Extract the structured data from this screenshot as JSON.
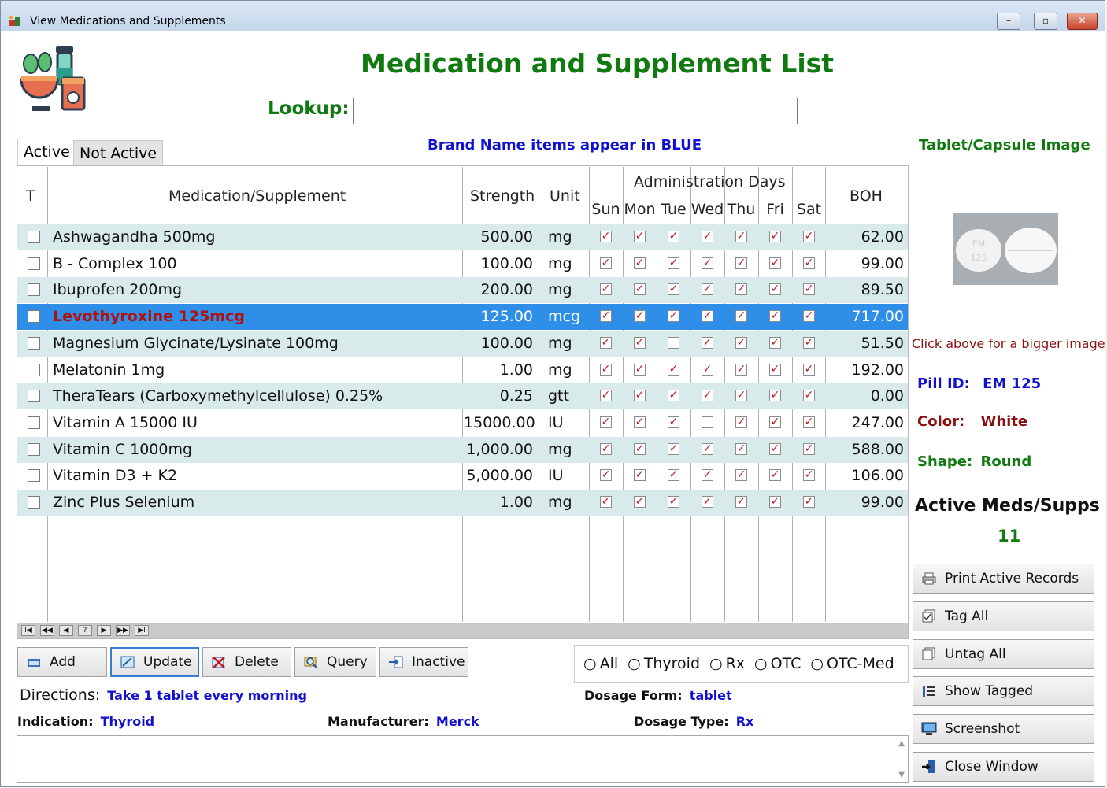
{
  "window": {
    "title": "View Medications and Supplements",
    "minimize": "–",
    "maximize": "▫",
    "close": "✕"
  },
  "heading": "Medication and Supplement List",
  "lookup": {
    "label": "Lookup:",
    "value": ""
  },
  "tabs": [
    {
      "label": "Active"
    },
    {
      "label": "Not Active"
    }
  ],
  "brand_note": "Brand Name items appear in BLUE",
  "table": {
    "headers": {
      "tag": "T",
      "name": "Medication/Supplement",
      "strength": "Strength",
      "unit": "Unit",
      "admin": "Administration Days",
      "boh": "BOH"
    },
    "days": [
      "Sun",
      "Mon",
      "Tue",
      "Wed",
      "Thu",
      "Fri",
      "Sat"
    ],
    "rows": [
      {
        "name": "Ashwagandha 500mg",
        "strength": "500.00",
        "unit": "mg",
        "days": [
          true,
          true,
          true,
          true,
          true,
          true,
          true
        ],
        "boh": "62.00",
        "selected": false
      },
      {
        "name": "B - Complex 100",
        "strength": "100.00",
        "unit": "mg",
        "days": [
          true,
          true,
          true,
          true,
          true,
          true,
          true
        ],
        "boh": "99.00",
        "selected": false
      },
      {
        "name": "Ibuprofen 200mg",
        "strength": "200.00",
        "unit": "mg",
        "days": [
          true,
          true,
          true,
          true,
          true,
          true,
          true
        ],
        "boh": "89.50",
        "selected": false
      },
      {
        "name": "Levothyroxine 125mcg",
        "strength": "125.00",
        "unit": "mcg",
        "days": [
          true,
          true,
          true,
          true,
          true,
          true,
          true
        ],
        "boh": "717.00",
        "selected": true
      },
      {
        "name": "Magnesium Glycinate/Lysinate 100mg",
        "strength": "100.00",
        "unit": "mg",
        "days": [
          true,
          true,
          false,
          true,
          true,
          true,
          true
        ],
        "boh": "51.50",
        "selected": false
      },
      {
        "name": "Melatonin 1mg",
        "strength": "1.00",
        "unit": "mg",
        "days": [
          true,
          true,
          true,
          true,
          true,
          true,
          true
        ],
        "boh": "192.00",
        "selected": false
      },
      {
        "name": "TheraTears (Carboxymethylcellulose) 0.25%",
        "strength": "0.25",
        "unit": "gtt",
        "days": [
          true,
          true,
          true,
          true,
          true,
          true,
          true
        ],
        "boh": "0.00",
        "selected": false
      },
      {
        "name": "Vitamin A 15000 IU",
        "strength": "15000.00",
        "unit": "IU",
        "days": [
          true,
          true,
          true,
          false,
          true,
          true,
          true
        ],
        "boh": "247.00",
        "selected": false
      },
      {
        "name": "Vitamin C 1000mg",
        "strength": "1,000.00",
        "unit": "mg",
        "days": [
          true,
          true,
          true,
          true,
          true,
          true,
          true
        ],
        "boh": "588.00",
        "selected": false
      },
      {
        "name": "Vitamin D3 + K2",
        "strength": "5,000.00",
        "unit": "IU",
        "days": [
          true,
          true,
          true,
          true,
          true,
          true,
          true
        ],
        "boh": "106.00",
        "selected": false
      },
      {
        "name": "Zinc Plus Selenium",
        "strength": "1.00",
        "unit": "mg",
        "days": [
          true,
          true,
          true,
          true,
          true,
          true,
          true
        ],
        "boh": "99.00",
        "selected": false
      }
    ]
  },
  "nav_buttons": [
    "I◀",
    "◀◀",
    "◀",
    "?",
    "▶",
    "▶▶",
    "▶I"
  ],
  "buttons": {
    "add": "Add",
    "update": "Update",
    "delete": "Delete",
    "query": "Query",
    "inactive": "Inactive"
  },
  "filters": [
    "All",
    "Thyroid",
    "Rx",
    "OTC",
    "OTC-Med"
  ],
  "directions": {
    "label": "Directions:",
    "value": "Take 1 tablet every morning"
  },
  "dosage_form": {
    "label": "Dosage Form:",
    "value": "tablet"
  },
  "indication": {
    "label": "Indication:",
    "value": "Thyroid"
  },
  "manufacturer": {
    "label": "Manufacturer:",
    "value": "Merck"
  },
  "dosage_type": {
    "label": "Dosage Type:",
    "value": "Rx"
  },
  "notes": "",
  "side": {
    "image_title": "Tablet/Capsule Image",
    "pill_imprint": [
      "EM",
      "125"
    ],
    "bigger_hint": "Click above for a bigger image",
    "pill_id": {
      "label": "Pill ID:",
      "value": "EM 125"
    },
    "color": {
      "label": "Color:",
      "value": "White"
    },
    "shape": {
      "label": "Shape:",
      "value": "Round"
    },
    "active_label": "Active Meds/Supps",
    "active_count": "11",
    "buttons": {
      "print": "Print Active Records",
      "tag_all": "Tag All",
      "untag_all": "Untag All",
      "show_tagged": "Show Tagged",
      "screenshot": "Screenshot",
      "close": "Close Window"
    }
  }
}
